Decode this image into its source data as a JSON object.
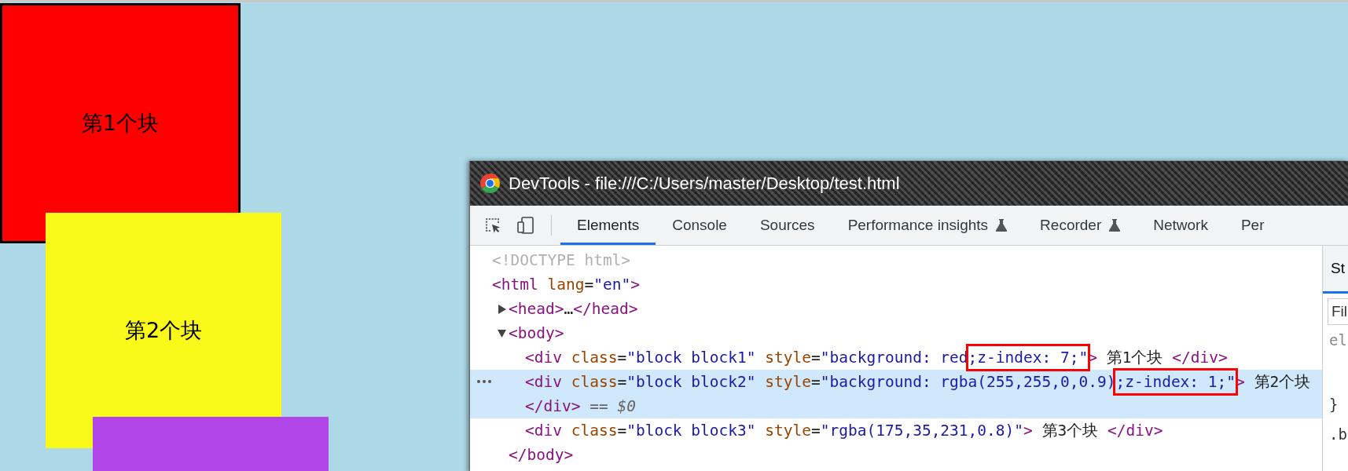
{
  "page": {
    "blocks": [
      {
        "label": "第1个块",
        "color": "#ff0000",
        "outlined": true
      },
      {
        "label": "第2个块",
        "color": "#f9f91a",
        "outlined": false
      },
      {
        "color": "#b045e8",
        "outlined": false
      }
    ]
  },
  "devtools": {
    "title": "DevTools - file:///C:/Users/master/Desktop/test.html",
    "tabs": [
      {
        "label": "Elements",
        "selected": true,
        "experimental": false
      },
      {
        "label": "Console",
        "selected": false,
        "experimental": false
      },
      {
        "label": "Sources",
        "selected": false,
        "experimental": false
      },
      {
        "label": "Performance insights",
        "selected": false,
        "experimental": true
      },
      {
        "label": "Recorder",
        "selected": false,
        "experimental": true
      },
      {
        "label": "Network",
        "selected": false,
        "experimental": false
      },
      {
        "label": "Per",
        "selected": false,
        "experimental": false
      }
    ],
    "elements_tree": [
      {
        "selected": false,
        "tokens": [
          {
            "kind": "doctype",
            "text": "<!DOCTYPE html>"
          }
        ]
      },
      {
        "selected": false,
        "tokens": [
          {
            "kind": "tag",
            "text": "<html"
          },
          {
            "kind": "attr",
            "text": " lang"
          },
          {
            "kind": "punct",
            "text": "="
          },
          {
            "kind": "value",
            "text": "\"en\""
          },
          {
            "kind": "tag",
            "text": ">"
          }
        ],
        "children": [
          {
            "selected": false,
            "expanded": false,
            "tokens": [
              {
                "kind": "tag",
                "text": "<head>"
              },
              {
                "kind": "text",
                "text": "…"
              },
              {
                "kind": "tag",
                "text": "</head>"
              }
            ]
          },
          {
            "selected": false,
            "expanded": true,
            "tokens": [
              {
                "kind": "tag",
                "text": "<body>"
              }
            ],
            "children": [
              {
                "selected": false,
                "tokens": [
                  {
                    "kind": "tag",
                    "text": "<div"
                  },
                  {
                    "kind": "attr",
                    "text": " class"
                  },
                  {
                    "kind": "punct",
                    "text": "="
                  },
                  {
                    "kind": "value",
                    "text": "\"block block1\""
                  },
                  {
                    "kind": "attr",
                    "text": " style"
                  },
                  {
                    "kind": "punct",
                    "text": "="
                  },
                  {
                    "kind": "value",
                    "text": "\"background: red"
                  },
                  {
                    "kind": "value",
                    "text": ";z-index: 7;\"",
                    "highlighted": true
                  },
                  {
                    "kind": "tag",
                    "text": ">"
                  },
                  {
                    "kind": "text",
                    "text": " 第1个块 "
                  },
                  {
                    "kind": "tag",
                    "text": "</div>"
                  }
                ]
              },
              {
                "selected": true,
                "tokens": [
                  {
                    "kind": "tag",
                    "text": "<div"
                  },
                  {
                    "kind": "attr",
                    "text": " class"
                  },
                  {
                    "kind": "punct",
                    "text": "="
                  },
                  {
                    "kind": "value",
                    "text": "\"block block2\""
                  },
                  {
                    "kind": "attr",
                    "text": " style"
                  },
                  {
                    "kind": "punct",
                    "text": "="
                  },
                  {
                    "kind": "value",
                    "text": "\"background: rgba(255,255,0,0.9)"
                  },
                  {
                    "kind": "value",
                    "text": ";z-index: 1;\"",
                    "highlighted": true
                  },
                  {
                    "kind": "tag",
                    "text": ">"
                  },
                  {
                    "kind": "text",
                    "text": " 第2个块"
                  }
                ],
                "wrap": [
                  {
                    "kind": "tag",
                    "text": "</div>"
                  },
                  {
                    "kind": "hint",
                    "text": " == $0"
                  }
                ]
              },
              {
                "selected": false,
                "tokens": [
                  {
                    "kind": "tag",
                    "text": "<div"
                  },
                  {
                    "kind": "attr",
                    "text": " class"
                  },
                  {
                    "kind": "punct",
                    "text": "="
                  },
                  {
                    "kind": "value",
                    "text": "\"block block3\""
                  },
                  {
                    "kind": "attr",
                    "text": " style"
                  },
                  {
                    "kind": "punct",
                    "text": "="
                  },
                  {
                    "kind": "value",
                    "text": "\"rgba(175,35,231,0.8)\""
                  },
                  {
                    "kind": "tag",
                    "text": ">"
                  },
                  {
                    "kind": "text",
                    "text": " 第3个块 "
                  },
                  {
                    "kind": "tag",
                    "text": "</div>"
                  }
                ]
              }
            ],
            "close": [
              {
                "kind": "tag",
                "text": "</body>"
              }
            ]
          }
        ]
      }
    ],
    "styles_pane": {
      "tabs": [
        {
          "label": "St",
          "selected": true
        }
      ],
      "filter": {
        "placeholder": "Fil"
      },
      "lines": [
        "el",
        "}",
        ".b"
      ]
    }
  }
}
